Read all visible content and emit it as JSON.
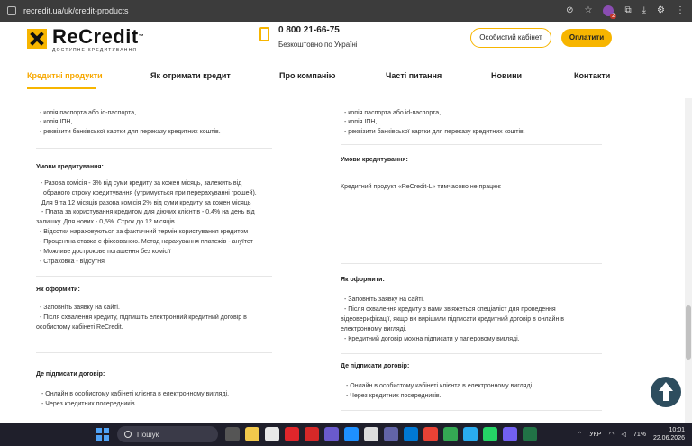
{
  "browser": {
    "url": "recredit.ua/uk/credit-products",
    "avatar_badge": "2"
  },
  "header": {
    "logo_name": "ReCredit",
    "logo_tm": "™",
    "logo_tagline": "ДОСТУПНЕ КРЕДИТУВАННЯ",
    "phone": "0 800 21-66-75",
    "phone_sub": "Безкоштовно по Україні",
    "cabinet_label": "Особистий кабінет",
    "pay_label": "Оплатити"
  },
  "nav": {
    "items": [
      "Кредитні продукти",
      "Як отримати кредит",
      "Про компанію",
      "Часті питання",
      "Новини",
      "Контакти"
    ],
    "active_index": 0
  },
  "left": {
    "docs": [
      "- копія паспорта або id-паспорта,",
      "- копія ІПН,",
      "- реквізити банківської картки для переказу кредитних коштів."
    ],
    "conditions_title": "Умови кредитування:",
    "conditions": [
      "- Разова комісія - 3% від суми кредиту за кожен місяць, залежить від",
      "  обраного строку кредитування (утримується при перерахуванні грошей).",
      "  Для 9 та 12 місяців разова комісія 2% від суми кредиту за кожен місяць",
      "- Плата за користування кредитом для діючих клієнтів - 0,4% на день від",
      "залишку. Для нових - 0,5%. Строк до 12 місяців",
      "- Відсотки нараховуються за фактичний термін користування кредитом",
      "- Процентна ставка є фіксованою. Метод нарахування платежів - ануїтет",
      "- Можливе дострокове погашення без комісії",
      "- Страховка - відсутня"
    ],
    "how_title": "Як оформити:",
    "how": [
      "- Заповніть заявку на сайті.",
      "- Після схвалення кредиту, підпишіть електронний кредитний договір в",
      "особистому кабінеті ReCredit."
    ],
    "sign_title": "Де підписати договір:",
    "sign": [
      "- Онлайн в особистому кабінеті клієнта в електронному вигляді.",
      "- Через кредитних посередників"
    ]
  },
  "right": {
    "docs": [
      "- копія паспорта або id-паспорта,",
      "- копія ІПН,",
      "- реквізити банківської картки для переказу кредитних коштів."
    ],
    "conditions_title": "Умови кредитування:",
    "conditions_text": "Кредитний продукт «ReCredit-L» тимчасово не працює",
    "how_title": "Як оформити:",
    "how": [
      "- Заповніть заявку на сайті.",
      "- Після схвалення кредиту з вами зв'яжеться спеціаліст для проведення",
      "відеоверифікації, якщо ви вирішили підписати кредитний договір в онлайн в",
      "електронному вигляді.",
      "- Кредитний договір можна підписати у паперовому вигляді."
    ],
    "sign_title": "Де підписати договір:",
    "sign": [
      "- Онлайн в особистому кабінеті клієнта в електронному вигляді.",
      "- Через кредитних посередників."
    ]
  },
  "taskbar": {
    "search_placeholder": "Пошук",
    "lang": "УКР",
    "battery": "71%",
    "time": "10:01",
    "date": "22.06.2026"
  },
  "colors": {
    "accent": "#f7b500",
    "dark_button": "#2d4d5e",
    "taskbar": "#1f1f2b"
  }
}
